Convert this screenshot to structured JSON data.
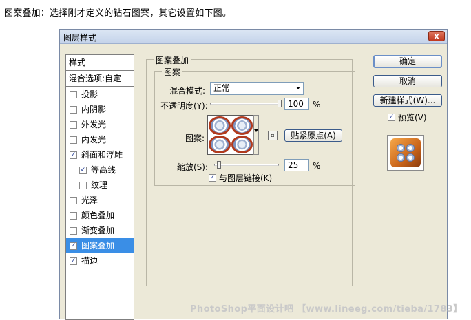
{
  "caption": "图案叠加：选择刚才定义的钻石图案，其它设置如下图。",
  "window": {
    "title": "图层样式",
    "close_label": "x"
  },
  "left_panel": {
    "header": "样式",
    "blend_options": "混合选项:自定",
    "items": [
      {
        "label": "投影",
        "checked": false
      },
      {
        "label": "内阴影",
        "checked": false
      },
      {
        "label": "外发光",
        "checked": false
      },
      {
        "label": "内发光",
        "checked": false
      },
      {
        "label": "斜面和浮雕",
        "checked": true
      },
      {
        "label": "等高线",
        "checked": true
      },
      {
        "label": "纹理",
        "checked": false
      },
      {
        "label": "光泽",
        "checked": false
      },
      {
        "label": "颜色叠加",
        "checked": false
      },
      {
        "label": "渐变叠加",
        "checked": false
      },
      {
        "label": "图案叠加",
        "checked": true,
        "selected": true
      },
      {
        "label": "描边",
        "checked": true
      }
    ]
  },
  "settings": {
    "group_title": "图案叠加",
    "subgroup_title": "图案",
    "blend_mode_label": "混合模式:",
    "blend_mode_value": "正常",
    "opacity_label": "不透明度(Y):",
    "opacity_value": "100",
    "opacity_unit": "%",
    "opacity_fraction": 1.0,
    "pattern_label": "图案:",
    "snap_origin_label": "贴紧原点(A)",
    "scale_label": "缩放(S):",
    "scale_value": "25",
    "scale_unit": "%",
    "scale_fraction": 0.05,
    "link_label": "与图层链接(K)",
    "link_checked": true
  },
  "buttons": {
    "ok": "确定",
    "cancel": "取消",
    "new_style": "新建样式(W)...",
    "preview": "预览(V)",
    "preview_checked": true
  },
  "watermark": "PhotoShop平面设计吧 【www.lineeg.com/tieba/1783】",
  "colors": {
    "selected_row": "#3a8ee6",
    "dialog_bg": "#ece9d8",
    "close_button": "#c0391f"
  }
}
